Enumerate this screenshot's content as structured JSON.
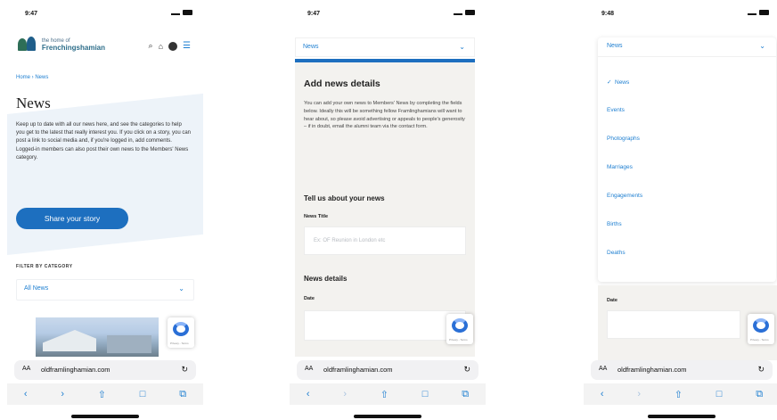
{
  "screen1": {
    "status_time": "9:47",
    "logo_line1": "the home of",
    "logo_line2": "Frenchingshamian",
    "breadcrumb": "Home › News",
    "page_title": "News",
    "intro_text": "Keep up to date with all our news here, and see the categories to help you get to the latest that really interest you. If you click on a story, you can post a link to social media and, if you're logged in, add comments. Logged-in members can also post their own news to the Members' News category.",
    "share_button": "Share your story",
    "filter_label": "FILTER BY CATEGORY",
    "filter_value": "All News",
    "url_text": "oldframlinghamian.com",
    "aa_label": "AA"
  },
  "screen2": {
    "status_time": "9:47",
    "category_value": "News",
    "form_title": "Add news details",
    "form_intro": "You can add your own news to Members' News by completing the fields below. Ideally this will be something fellow Framlinghamians will want to hear about, so please avoid advertising or appeals to people's generosity – if in doubt, email the alumni team via the contact form.",
    "section_title": "Tell us about your news",
    "news_title_label": "News Title",
    "news_title_placeholder": "Ex: OF Reunion in London etc",
    "details_title": "News details",
    "date_label": "Date",
    "url_text": "oldframlinghamian.com",
    "aa_label": "AA"
  },
  "screen3": {
    "status_time": "9:48",
    "category_value": "News",
    "options": [
      "News",
      "Events",
      "Photographs",
      "Marriages",
      "Engagements",
      "Births",
      "Deaths"
    ],
    "selected_index": 0,
    "date_label": "Date",
    "url_text": "oldframlinghamian.com",
    "aa_label": "AA"
  },
  "icons": {
    "back": "‹",
    "forward": "›",
    "share": "⇧",
    "bookmarks": "□",
    "tabs": "⧉",
    "reload": "↻",
    "chevron": "⌄",
    "check": "✓",
    "search": "⌕"
  },
  "colors": {
    "accent": "#1d6fbf",
    "link": "#1e7fd1",
    "panel": "#f3f2ef",
    "intro_bg": "#edf3f9"
  }
}
